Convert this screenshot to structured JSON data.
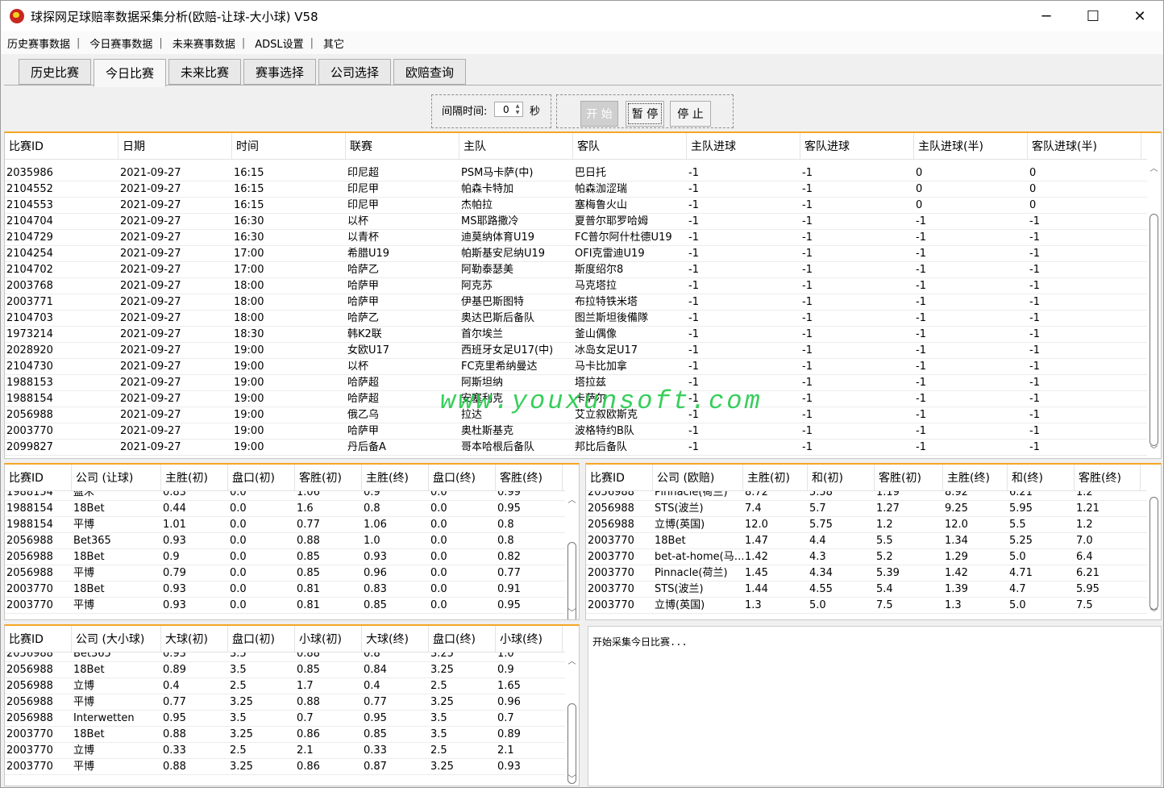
{
  "app": {
    "title": "球探网足球赔率数据采集分析(欧赔-让球-大小球) V58",
    "window_buttons": [
      "─",
      "☐",
      "✕"
    ]
  },
  "menu": [
    "历史赛事数据",
    "今日赛事数据",
    "未来赛事数据",
    "ADSL设置",
    "其它"
  ],
  "menu_sep": "|",
  "tabs": [
    {
      "label": "历史比赛",
      "active": false
    },
    {
      "label": "今日比赛",
      "active": true
    },
    {
      "label": "未来比赛",
      "active": false
    },
    {
      "label": "赛事选择",
      "active": false
    },
    {
      "label": "公司选择",
      "active": false
    },
    {
      "label": "欧赔查询",
      "active": false
    }
  ],
  "controls": {
    "interval_label": "间隔时间:",
    "interval_value": "0",
    "unit": "秒",
    "start": "开 始",
    "pause": "暂 停",
    "stop": "停 止"
  },
  "match_table": {
    "columns": [
      "比赛ID",
      "日期",
      "时间",
      "联赛",
      "主队",
      "客队",
      "主队进球",
      "客队进球",
      "主队进球(半)",
      "客队进球(半)"
    ],
    "rows": [
      [
        "2035986",
        "2021-09-27",
        "16:15",
        "印尼超",
        "PSM马卡萨(中)",
        "巴日托",
        "-1",
        "-1",
        "0",
        "0"
      ],
      [
        "2104552",
        "2021-09-27",
        "16:15",
        "印尼甲",
        "帕森卡特加",
        "帕森泇涩瑞",
        "-1",
        "-1",
        "0",
        "0"
      ],
      [
        "2104553",
        "2021-09-27",
        "16:15",
        "印尼甲",
        "杰帕拉",
        "塞梅鲁火山",
        "-1",
        "-1",
        "0",
        "0"
      ],
      [
        "2104704",
        "2021-09-27",
        "16:30",
        "以杯",
        "MS耶路撒冷",
        "夏普尔耶罗哈姆",
        "-1",
        "-1",
        "-1",
        "-1"
      ],
      [
        "2104729",
        "2021-09-27",
        "16:30",
        "以青杯",
        "迪莫纳体育U19",
        "FC普尔阿什杜德U19",
        "-1",
        "-1",
        "-1",
        "-1"
      ],
      [
        "2104254",
        "2021-09-27",
        "17:00",
        "希腊U19",
        "帕斯基安尼纳U19",
        "OFI克雷迪U19",
        "-1",
        "-1",
        "-1",
        "-1"
      ],
      [
        "2104702",
        "2021-09-27",
        "17:00",
        "哈萨乙",
        "阿勒泰瑟美",
        "斯度绍尔8",
        "-1",
        "-1",
        "-1",
        "-1"
      ],
      [
        "2003768",
        "2021-09-27",
        "18:00",
        "哈萨甲",
        "阿克苏",
        "马克塔拉",
        "-1",
        "-1",
        "-1",
        "-1"
      ],
      [
        "2003771",
        "2021-09-27",
        "18:00",
        "哈萨甲",
        "伊基巴斯图特",
        "布拉特铁米塔",
        "-1",
        "-1",
        "-1",
        "-1"
      ],
      [
        "2104703",
        "2021-09-27",
        "18:00",
        "哈萨乙",
        "奥达巴斯后备队",
        "图兰斯坦後備隊",
        "-1",
        "-1",
        "-1",
        "-1"
      ],
      [
        "1973214",
        "2021-09-27",
        "18:30",
        "韩K2联",
        "首尔埃兰",
        "釜山偶像",
        "-1",
        "-1",
        "-1",
        "-1"
      ],
      [
        "2028920",
        "2021-09-27",
        "19:00",
        "女欧U17",
        "西班牙女足U17(中)",
        "冰岛女足U17",
        "-1",
        "-1",
        "-1",
        "-1"
      ],
      [
        "2104730",
        "2021-09-27",
        "19:00",
        "以杯",
        "FC克里希纳曼达",
        "马卡比加拿",
        "-1",
        "-1",
        "-1",
        "-1"
      ],
      [
        "1988153",
        "2021-09-27",
        "19:00",
        "哈萨超",
        "阿斯坦纳",
        "塔拉兹",
        "-1",
        "-1",
        "-1",
        "-1"
      ],
      [
        "1988154",
        "2021-09-27",
        "19:00",
        "哈萨超",
        "安塞利克",
        "卡萨尔",
        "-1",
        "-1",
        "-1",
        "-1"
      ],
      [
        "2056988",
        "2021-09-27",
        "19:00",
        "俄乙乌",
        "拉达",
        "艾立叙欧斯克",
        "-1",
        "-1",
        "-1",
        "-1"
      ],
      [
        "2003770",
        "2021-09-27",
        "19:00",
        "哈萨甲",
        "奥杜斯基克",
        "波格特约B队",
        "-1",
        "-1",
        "-1",
        "-1"
      ],
      [
        "2099827",
        "2021-09-27",
        "19:00",
        "丹后备A",
        "哥本哈根后备队",
        "邦比后备队",
        "-1",
        "-1",
        "-1",
        "-1"
      ]
    ]
  },
  "handicap_table": {
    "columns": [
      "比赛ID",
      "公司 (让球)",
      "主胜(初)",
      "盘口(初)",
      "客胜(初)",
      "主胜(终)",
      "盘口(终)",
      "客胜(终)"
    ],
    "partial_row": [
      "1988154",
      "盈禾",
      "0.83",
      "0.0",
      "1.06",
      "0.9",
      "0.0",
      "0.99"
    ],
    "rows": [
      [
        "1988154",
        "18Bet",
        "0.44",
        "0.0",
        "1.6",
        "0.8",
        "0.0",
        "0.95"
      ],
      [
        "1988154",
        "平博",
        "1.01",
        "0.0",
        "0.77",
        "1.06",
        "0.0",
        "0.8"
      ],
      [
        "2056988",
        "Bet365",
        "0.93",
        "0.0",
        "0.88",
        "1.0",
        "0.0",
        "0.8"
      ],
      [
        "2056988",
        "18Bet",
        "0.9",
        "0.0",
        "0.85",
        "0.93",
        "0.0",
        "0.82"
      ],
      [
        "2056988",
        "平博",
        "0.79",
        "0.0",
        "0.85",
        "0.96",
        "0.0",
        "0.77"
      ],
      [
        "2003770",
        "18Bet",
        "0.93",
        "0.0",
        "0.81",
        "0.83",
        "0.0",
        "0.91"
      ],
      [
        "2003770",
        "平博",
        "0.93",
        "0.0",
        "0.81",
        "0.85",
        "0.0",
        "0.95"
      ]
    ]
  },
  "euro_table": {
    "columns": [
      "比赛ID",
      "公司 (欧赔)",
      "主胜(初)",
      "和(初)",
      "客胜(初)",
      "主胜(终)",
      "和(终)",
      "客胜(终)"
    ],
    "partial_row": [
      "2056988",
      "Pinnacle(荷兰)",
      "8.72",
      "5.58",
      "1.19",
      "8.92",
      "6.21",
      "1.2"
    ],
    "rows": [
      [
        "2056988",
        "STS(波兰)",
        "7.4",
        "5.7",
        "1.27",
        "9.25",
        "5.95",
        "1.21"
      ],
      [
        "2056988",
        "立博(英国)",
        "12.0",
        "5.75",
        "1.2",
        "12.0",
        "5.5",
        "1.2"
      ],
      [
        "2003770",
        "18Bet",
        "1.47",
        "4.4",
        "5.5",
        "1.34",
        "5.25",
        "7.0"
      ],
      [
        "2003770",
        "bet-at-home(马…",
        "1.42",
        "4.3",
        "5.2",
        "1.29",
        "5.0",
        "6.4"
      ],
      [
        "2003770",
        "Pinnacle(荷兰)",
        "1.45",
        "4.34",
        "5.39",
        "1.42",
        "4.71",
        "6.21"
      ],
      [
        "2003770",
        "STS(波兰)",
        "1.44",
        "4.55",
        "5.4",
        "1.39",
        "4.7",
        "5.95"
      ],
      [
        "2003770",
        "立博(英国)",
        "1.3",
        "5.0",
        "7.5",
        "1.3",
        "5.0",
        "7.5"
      ]
    ]
  },
  "ou_table": {
    "columns": [
      "比赛ID",
      "公司 (大小球)",
      "大球(初)",
      "盘口(初)",
      "小球(初)",
      "大球(终)",
      "盘口(终)",
      "小球(终)"
    ],
    "partial_row": [
      "2056988",
      "Bet365",
      "0.93",
      "3.5",
      "0.88",
      "0.8",
      "3.25",
      "1.0"
    ],
    "rows": [
      [
        "2056988",
        "18Bet",
        "0.89",
        "3.5",
        "0.85",
        "0.84",
        "3.25",
        "0.9"
      ],
      [
        "2056988",
        "立博",
        "0.4",
        "2.5",
        "1.7",
        "0.4",
        "2.5",
        "1.65"
      ],
      [
        "2056988",
        "平博",
        "0.77",
        "3.25",
        "0.88",
        "0.77",
        "3.25",
        "0.96"
      ],
      [
        "2056988",
        "Interwetten",
        "0.95",
        "3.5",
        "0.7",
        "0.95",
        "3.5",
        "0.7"
      ],
      [
        "2003770",
        "18Bet",
        "0.88",
        "3.25",
        "0.86",
        "0.85",
        "3.5",
        "0.89"
      ],
      [
        "2003770",
        "立博",
        "0.33",
        "2.5",
        "2.1",
        "0.33",
        "2.5",
        "2.1"
      ],
      [
        "2003770",
        "平博",
        "0.88",
        "3.25",
        "0.86",
        "0.87",
        "3.25",
        "0.93"
      ]
    ]
  },
  "log": {
    "text": "开始采集今日比赛..."
  },
  "watermark": "www.youxunsoft.com",
  "icons": {
    "arrow_up": "︿",
    "arrow_down": "﹀"
  }
}
